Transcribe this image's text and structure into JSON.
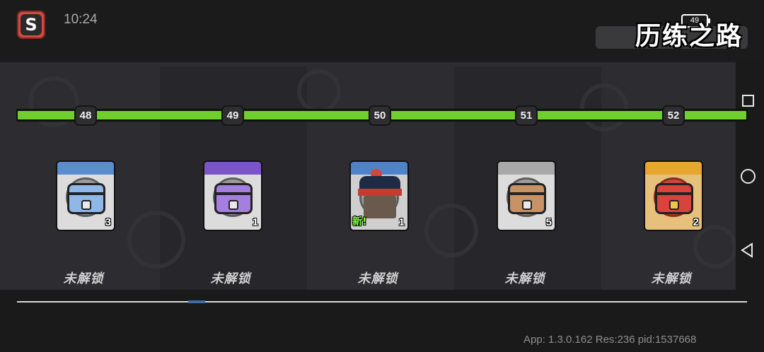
{
  "status_bar": {
    "time": "10:24",
    "battery": "49"
  },
  "header": {
    "title": "历练之路"
  },
  "levels": [
    "48",
    "49",
    "50",
    "51",
    "52"
  ],
  "rewards": [
    {
      "name": "蓝色宝箱",
      "icon": "blue-chest-icon",
      "count": "3",
      "status": "未解锁",
      "accent": "#5b8ccc"
    },
    {
      "name": "紫色宝箱",
      "icon": "purple-chest-icon",
      "count": "1",
      "status": "未解锁",
      "accent": "#7b55c6"
    },
    {
      "name": "英雄",
      "icon": "pirate-hero-icon",
      "count": "1",
      "new_label": "新!",
      "status": "未解锁",
      "accent": "#4f82c8"
    },
    {
      "name": "木质宝箱",
      "icon": "wood-chest-icon",
      "count": "5",
      "status": "未解锁",
      "accent": "#a8a8a8"
    },
    {
      "name": "金色宝箱",
      "icon": "gold-chest-icon",
      "count": "2",
      "status": "未解锁",
      "accent": "#e8a630"
    }
  ],
  "progress_color": "#6fcf2c",
  "footer": {
    "info": "App: 1.3.0.162 Res:236 pid:1537668"
  },
  "nav": {
    "recent": "square-icon",
    "home": "circle-icon",
    "back": "triangle-back-icon"
  }
}
